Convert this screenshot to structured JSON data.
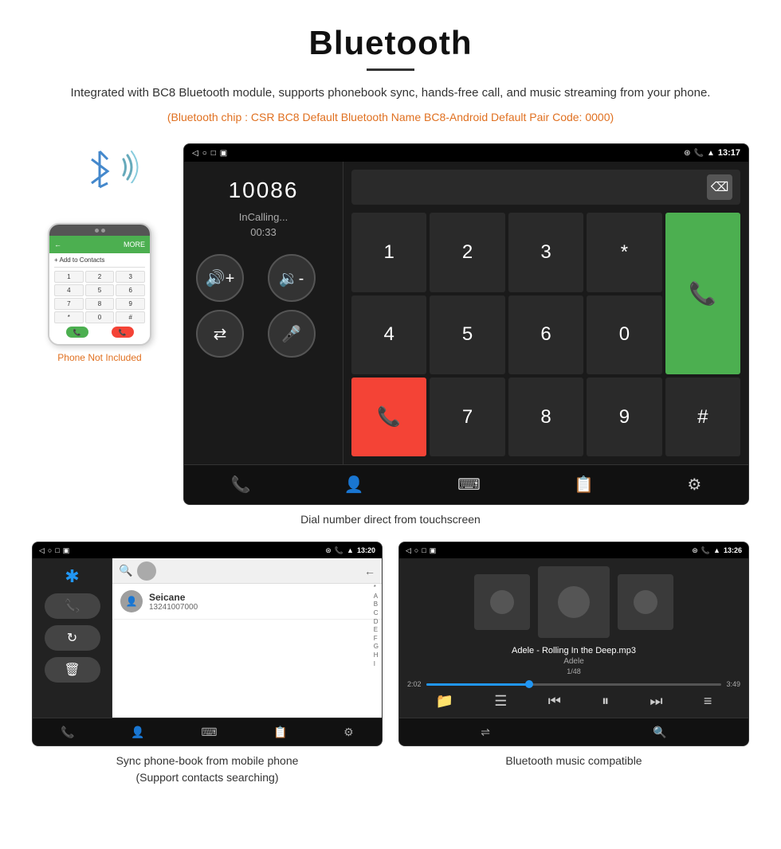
{
  "page": {
    "title": "Bluetooth",
    "title_underline": true
  },
  "description": {
    "main": "Integrated with BC8 Bluetooth module, supports phonebook sync, hands-free call, and music streaming from your phone.",
    "specs": "(Bluetooth chip : CSR BC8   Default Bluetooth Name BC8-Android   Default Pair Code: 0000)"
  },
  "phone_label": "Phone Not Included",
  "dial_screen": {
    "status_time": "13:17",
    "number": "10086",
    "status": "InCalling...",
    "timer": "00:33"
  },
  "dial_caption": "Dial number direct from touchscreen",
  "contacts_screen": {
    "status_time": "13:20",
    "contact_name": "Seicane",
    "contact_number": "13241007000",
    "alpha_letters": [
      "*",
      "A",
      "B",
      "C",
      "D",
      "E",
      "F",
      "G",
      "H",
      "I"
    ]
  },
  "contacts_caption": "Sync phone-book from mobile phone\n(Support contacts searching)",
  "music_screen": {
    "status_time": "13:26",
    "song_title": "Adele - Rolling In the Deep.mp3",
    "artist": "Adele",
    "track": "1/48",
    "time_current": "2:02",
    "time_total": "3:49"
  },
  "music_caption": "Bluetooth music compatible",
  "icons": {
    "bluetooth": "⚡",
    "phone": "📞",
    "back": "◁",
    "home": "○",
    "recent": "□",
    "volume_up": "🔊",
    "volume_down": "🔉",
    "transfer": "⇄",
    "mute": "🎤",
    "call_green": "📞",
    "call_red": "📞",
    "contacts": "👤",
    "keypad": "⌨",
    "history": "📋",
    "settings": "⚙",
    "search": "🔍",
    "shuffle": "⇌",
    "prev": "⏮",
    "play": "⏸",
    "next": "⏭",
    "equalizer": "≡"
  }
}
